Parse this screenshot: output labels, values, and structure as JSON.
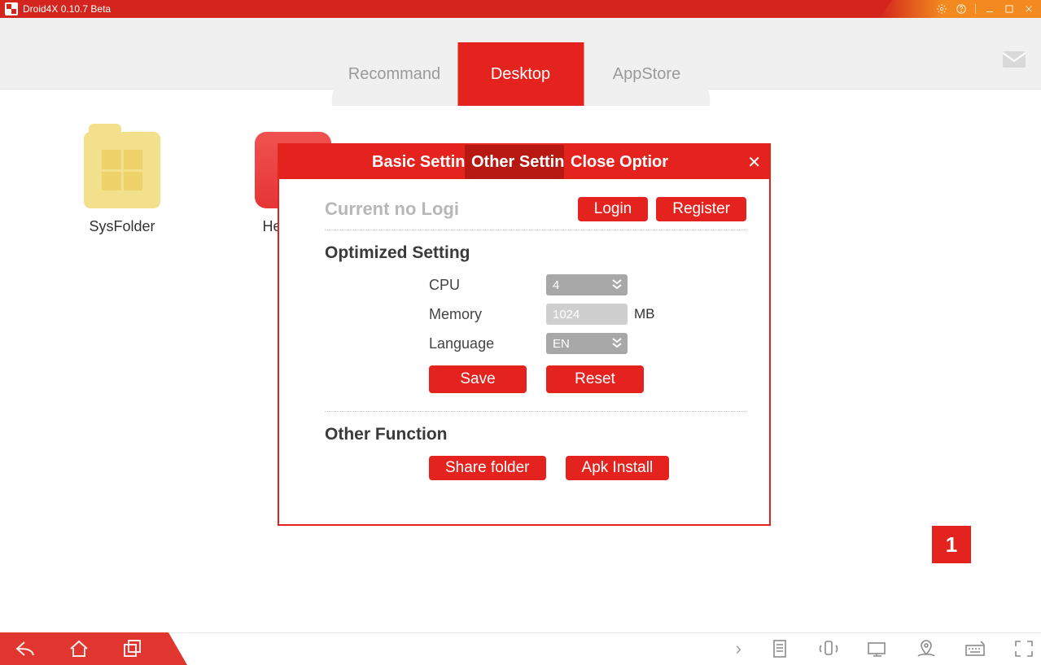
{
  "title": "Droid4X 0.10.7 Beta",
  "tabs": {
    "recommend": "Recommand",
    "desktop": "Desktop",
    "appstore": "AppStore"
  },
  "desktop": {
    "apps": [
      {
        "label": "SysFolder"
      },
      {
        "label": "HelpCent"
      }
    ]
  },
  "dialog": {
    "tabs": {
      "basic": "Basic Settin",
      "other": "Other Settin",
      "close": "Close Optior"
    },
    "login_status": "Current no Logi",
    "login_btn": "Login",
    "register_btn": "Register",
    "optimized_title": "Optimized Setting",
    "cpu_label": "CPU",
    "cpu_value": "4",
    "memory_label": "Memory",
    "memory_value": "1024",
    "memory_unit": "MB",
    "language_label": "Language",
    "language_value": "EN",
    "save_btn": "Save",
    "reset_btn": "Reset",
    "other_title": "Other Function",
    "share_btn": "Share folder",
    "apk_btn": "Apk Install"
  },
  "page_indicator": "1"
}
